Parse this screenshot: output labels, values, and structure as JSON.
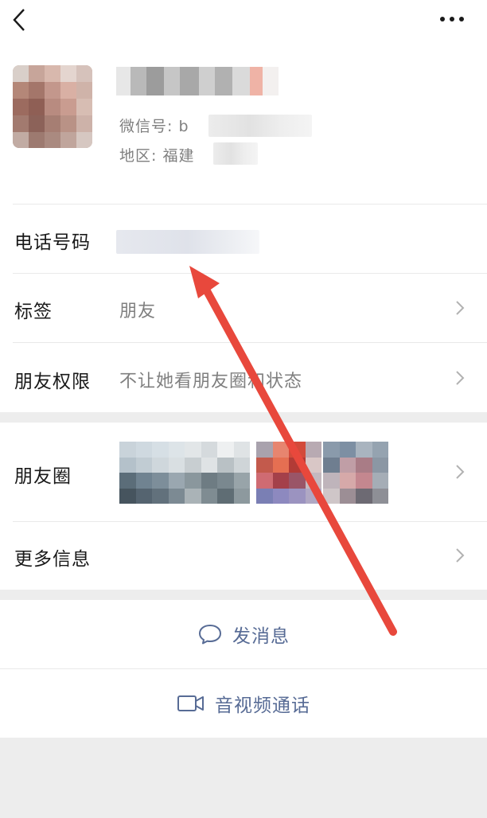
{
  "nav": {
    "back_icon": "chevron-left-icon",
    "more_icon": "more-dots-icon"
  },
  "profile": {
    "wechat_id_label": "微信号: b",
    "region_label": "地区: 福建"
  },
  "rows": {
    "phone": {
      "label": "电话号码"
    },
    "tags": {
      "label": "标签",
      "value": "朋友"
    },
    "permissions": {
      "label": "朋友权限",
      "value": "不让她看朋友圈和状态"
    },
    "moments": {
      "label": "朋友圈"
    },
    "more_info": {
      "label": "更多信息"
    }
  },
  "actions": {
    "message": {
      "label": "发消息",
      "icon": "chat-bubble-icon"
    },
    "call": {
      "label": "音视频通话",
      "icon": "video-camera-icon"
    }
  },
  "colors": {
    "link": "#576b95",
    "annotation_arrow": "#e8483c",
    "background": "#ededed"
  }
}
